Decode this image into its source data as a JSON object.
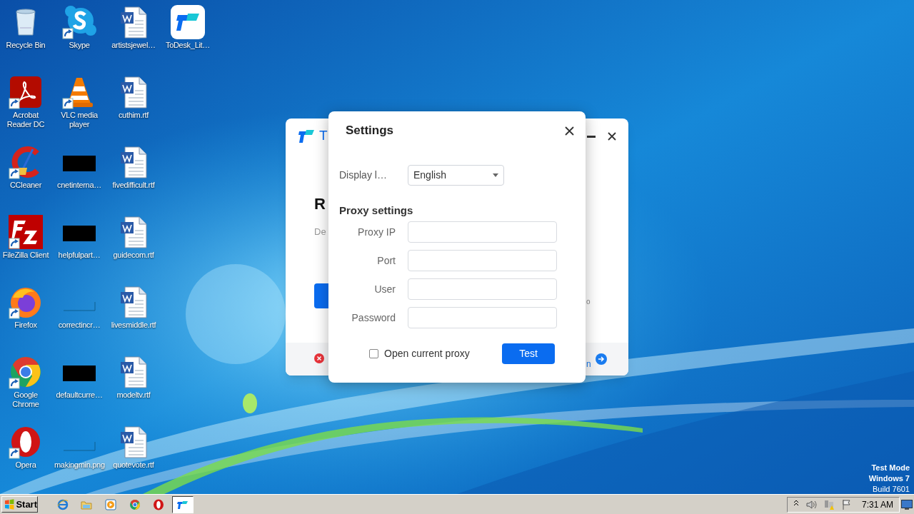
{
  "desktop": {
    "icon_columns": [
      [
        {
          "label": "Recycle Bin",
          "kind": "recycle",
          "shortcut": false
        },
        {
          "label": "Acrobat Reader DC",
          "kind": "acrobat",
          "shortcut": true
        },
        {
          "label": "CCleaner",
          "kind": "ccleaner",
          "shortcut": true
        },
        {
          "label": "FileZilla Client",
          "kind": "filezilla",
          "shortcut": true
        },
        {
          "label": "Firefox",
          "kind": "firefox",
          "shortcut": true
        },
        {
          "label": "Google Chrome",
          "kind": "chrome",
          "shortcut": true
        },
        {
          "label": "Opera",
          "kind": "opera",
          "shortcut": true
        }
      ],
      [
        {
          "label": "Skype",
          "kind": "skype",
          "shortcut": true
        },
        {
          "label": "VLC media player",
          "kind": "vlc",
          "shortcut": true
        },
        {
          "label": "cnetinterna…",
          "kind": "dark_thumbnail",
          "shortcut": false
        },
        {
          "label": "helpfulpart…",
          "kind": "dark_thumbnail",
          "shortcut": false
        },
        {
          "label": "correctincr…",
          "kind": "blank_thumbnail",
          "shortcut": false
        },
        {
          "label": "defaultcurre…",
          "kind": "dark_thumbnail",
          "shortcut": false
        },
        {
          "label": "makingmin.png",
          "kind": "blank_thumbnail",
          "shortcut": false
        }
      ],
      [
        {
          "label": "artistsjewel…",
          "kind": "document",
          "shortcut": false
        },
        {
          "label": "cuthim.rtf",
          "kind": "document",
          "shortcut": false
        },
        {
          "label": "fivedifficult.rtf",
          "kind": "document",
          "shortcut": false
        },
        {
          "label": "guidecom.rtf",
          "kind": "document",
          "shortcut": false
        },
        {
          "label": "livesmiddle.rtf",
          "kind": "document",
          "shortcut": false
        },
        {
          "label": "modeltv.rtf",
          "kind": "document",
          "shortcut": false
        },
        {
          "label": "quotevote.rtf",
          "kind": "document",
          "shortcut": false
        }
      ],
      [
        {
          "label": "ToDesk_Lit…",
          "kind": "todesk",
          "shortcut": false
        }
      ]
    ]
  },
  "background_window": {
    "logo_text": "T",
    "heading": "R",
    "description": "De",
    "side_fragment": "o",
    "footer_fragment": "n"
  },
  "settings_dialog": {
    "title": "Settings",
    "language": {
      "label": "Display l…",
      "value": "English"
    },
    "proxy_heading": "Proxy settings",
    "fields": [
      {
        "label": "Proxy IP"
      },
      {
        "label": "Port"
      },
      {
        "label": "User"
      },
      {
        "label": "Password"
      }
    ],
    "open_current_proxy": {
      "label": "Open current proxy",
      "checked": false
    },
    "test_button": "Test"
  },
  "taskbar": {
    "start": "Start",
    "items": [
      {
        "kind": "ie",
        "selected": false
      },
      {
        "kind": "explorer",
        "selected": false
      },
      {
        "kind": "media",
        "selected": false
      },
      {
        "kind": "chrome",
        "selected": false
      },
      {
        "kind": "opera",
        "selected": false
      },
      {
        "kind": "todesk",
        "selected": true
      }
    ],
    "clock": "7:31 AM"
  },
  "system_notice": [
    {
      "text": "Test Mode",
      "bold": true
    },
    {
      "text": "Windows 7",
      "bold": true
    },
    {
      "text": "Build 7601",
      "bold": false
    }
  ]
}
